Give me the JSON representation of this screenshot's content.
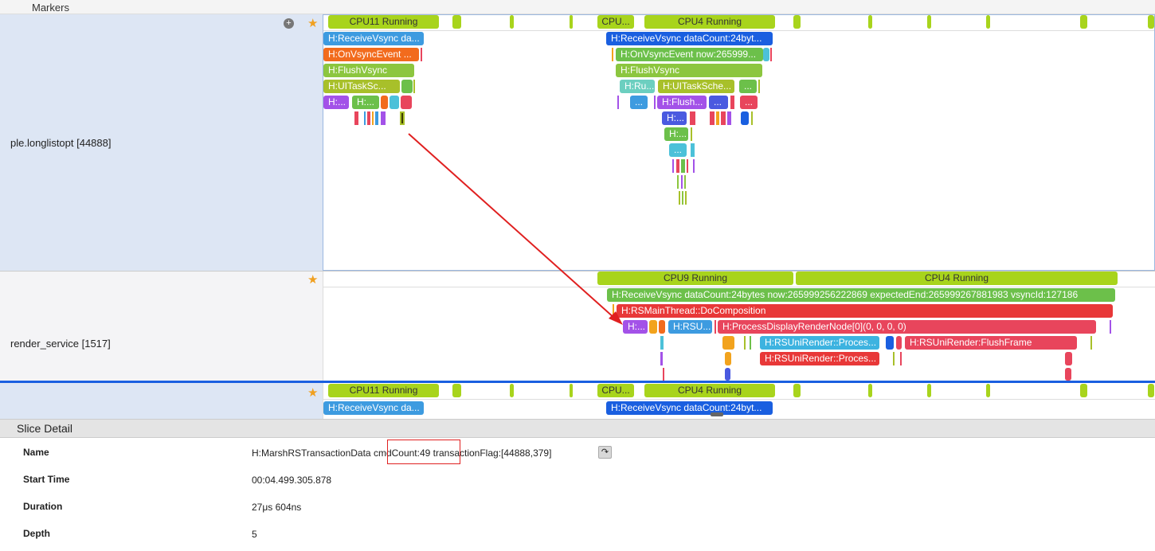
{
  "markers_label": "Markers",
  "tracks": [
    {
      "name": "ple.longlistopt [44888]"
    },
    {
      "name": "render_service [1517]"
    }
  ],
  "track1": {
    "cpu": [
      "CPU11 Running",
      "CPU...",
      "CPU4 Running"
    ],
    "s_recv1": "H:ReceiveVsync da...",
    "s_recv2": "H:ReceiveVsync dataCount:24byt...",
    "s_onv1": "H:OnVsyncEvent ...",
    "s_onv2": "H:OnVsyncEvent now:265999...",
    "s_flush1": "H:FlushVsync",
    "s_flush2": "H:FlushVsync",
    "s_uitask1": "H:UITaskSc...",
    "s_uitask2": "H:UITaskSche...",
    "s_ru": "H:Ru...",
    "s_dots": "...",
    "s_h1": "H:...",
    "s_h2": "H:...",
    "s_flush3": "H:Flush...",
    "s_h3": "H:...",
    "s_h4": "H:..."
  },
  "track2": {
    "cpu": [
      "CPU9 Running",
      "CPU4 Running"
    ],
    "s_recv": "H:ReceiveVsync dataCount:24bytes now:265999256222869 expectedEnd:265999267881983 vsyncId:127186",
    "s_comp": "H:RSMainThread::DoComposition",
    "s_h": "H:...",
    "s_rsu": "H:RSU...",
    "s_proc": "H:ProcessDisplayRenderNode[0](0, 0, 0, 0)",
    "s_uni1": "H:RSUniRender::Proces...",
    "s_flushframe": "H:RSUniRender:FlushFrame",
    "s_uni2": "H:RSUniRender::Proces..."
  },
  "track3": {
    "cpu": [
      "CPU11 Running",
      "CPU...",
      "CPU4 Running"
    ],
    "s_recv1": "H:ReceiveVsync da...",
    "s_recv2": "H:ReceiveVsync dataCount:24byt..."
  },
  "detail": {
    "title": "Slice Detail",
    "rows": [
      {
        "label": "Name",
        "value": "H:MarshRSTransactionData cmdCount:49 transactionFlag:[44888,379]"
      },
      {
        "label": "Start Time",
        "value": "00:04.499.305.878"
      },
      {
        "label": "Duration",
        "value": "27μs 604ns"
      },
      {
        "label": "Depth",
        "value": "5"
      }
    ],
    "highlight_text": "cmdCount:49"
  },
  "icons": {
    "star": "star-icon",
    "plus": "plus-circle-icon",
    "jump": "jump-arrow-icon",
    "collapse": "triangle-down-icon"
  },
  "colors": {
    "cpu": "#a8d41c",
    "blue": "#1a5fe0",
    "orange": "#f26b1d",
    "green": "#6cc04a",
    "red": "#e8455c",
    "purple": "#a352e8",
    "cyan": "#4cc1d9",
    "annotation": "#e02020"
  }
}
